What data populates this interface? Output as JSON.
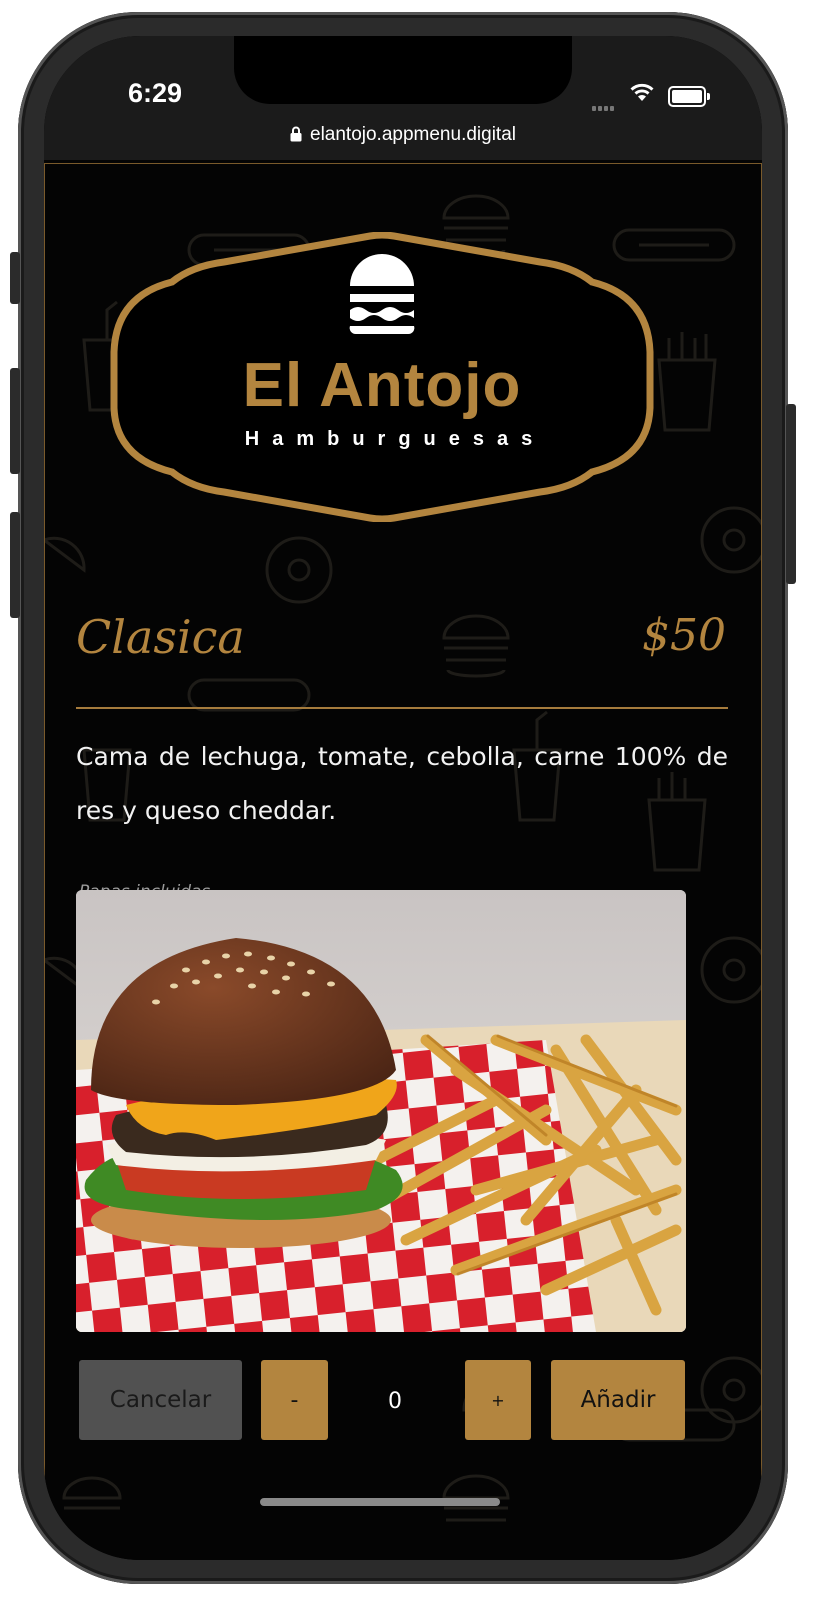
{
  "status_bar": {
    "time": "6:29"
  },
  "browser": {
    "url": "elantojo.appmenu.digital"
  },
  "logo": {
    "title": "El Antojo",
    "subtitle": "Hamburguesas"
  },
  "item": {
    "name": "Clasica",
    "price": "$50",
    "description": "Cama de lechuga, tomate, cebolla, carne 100% de res y queso cheddar.",
    "note": "Papas incluidas"
  },
  "controls": {
    "cancel_label": "Cancelar",
    "minus_label": "-",
    "quantity": "0",
    "plus_label": "+",
    "add_label": "Añadir"
  },
  "colors": {
    "accent_gold": "#b3853f",
    "background": "#040404",
    "cancel_gray": "#515151"
  }
}
